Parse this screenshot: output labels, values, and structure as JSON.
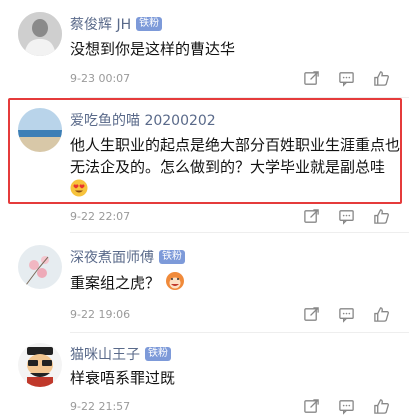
{
  "comments": [
    {
      "name": "蔡俊辉 JH",
      "badge": "铁粉",
      "text": "没想到你是这样的曹达华",
      "time": "9-23 00:07"
    },
    {
      "name": "爱吃鱼的喵 20200202",
      "badge": "",
      "text": "他人生职业的起点是绝大部分百姓职业生涯重点也无法企及的。怎么做到的？大学毕业就是副总哇",
      "time": "9-22 22:07"
    },
    {
      "name": "深夜煮面师傅",
      "badge": "铁粉",
      "text": "重案组之虎？",
      "time": "9-22 19:06"
    },
    {
      "name": "猫咪山王子",
      "badge": "铁粉",
      "text": "样衰唔系罪过既",
      "time": "9-22 21:57"
    }
  ],
  "icons": {
    "action_1": "share-icon",
    "action_2": "comment-icon",
    "action_3": "like-icon"
  },
  "colors": {
    "highlight": "#e53b3b",
    "badge": "#7d9ad9",
    "name": "#5a6a8a"
  }
}
